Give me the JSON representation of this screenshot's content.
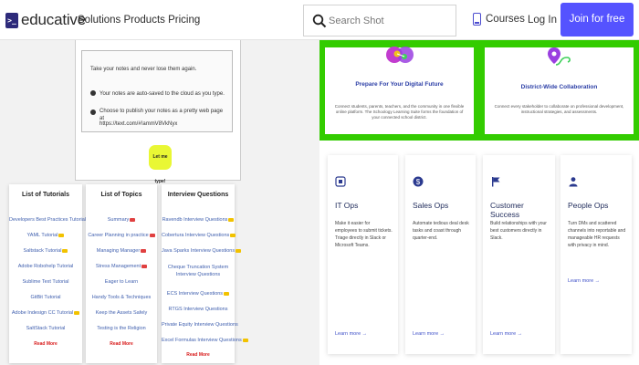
{
  "header": {
    "logo_text": "educative",
    "logo_glyph": ">_",
    "nav": "Solutions Products Pricing",
    "search_placeholder": "Search Shot",
    "courses": "Courses",
    "login": "Log In",
    "join": "Join for free",
    "accent_color": "#5553ff"
  },
  "promo": {
    "line1": "Take your notes and never lose them again.",
    "bullet1": "Your notes are auto-saved to the cloud as you type.",
    "bullet2a": "Choose to publish your notes as a pretty web page at",
    "bullet2b": "https://text.com/#!ammV8VkNyx",
    "button": "Let me type!"
  },
  "tutorials": {
    "title": "List of Tutorials",
    "items": [
      "Developers Best Practices Tutorial",
      "YAML Tutorial",
      "Saltstack Tutorial",
      "Adobe Robohelp Tutorial",
      "Sublime Text Tutorial",
      "GitBit Tutorial",
      "Adobe Indesign CC Tutorial",
      "SaltStack Tutorial"
    ],
    "more": "Read More"
  },
  "topics": {
    "title": "List of Topics",
    "items": [
      "Summary",
      "Career Planning in practice",
      "Managing Manager",
      "Stress Management",
      "Eager to Learn",
      "Handy Tools & Techniques",
      "Keep the Assets Safely",
      "Testing is the Religion"
    ],
    "more": "Read More"
  },
  "interview": {
    "title": "Interview Questions",
    "items": [
      "Ravendb Interview Questions",
      "Cobertura Interview Questions",
      "Java Sparks Interview Questions",
      "Cheque Truncation System Interview Questions",
      "ECS Interview Questions",
      "RTGS Interview Questions",
      "Private Equity Interview Questions",
      "Excel Formulas Interview Questions"
    ],
    "more": "Read More"
  },
  "features": [
    {
      "title": "Prepare For Your Digital Future",
      "desc": "Connect students, parents, teachers, and the community in one flexible online platform. The Schoology Learning Suite forms the foundation of your connected school district."
    },
    {
      "title": "District-Wide Collaboration",
      "desc": "Connect every stakeholder to collaborate on professional development, instructional strategies, and assessments."
    }
  ],
  "ops": [
    {
      "title": "IT Ops",
      "desc": "Make it easier for employees to submit tickets. Triage directly in Slack or Microsoft Teams.",
      "learn": "Learn more →"
    },
    {
      "title": "Sales Ops",
      "desc": "Automate tedious deal desk tasks and coast through quarter-end.",
      "learn": "Learn more →"
    },
    {
      "title": "Customer Success",
      "desc": "Build relationships with your best customers directly in Slack.",
      "learn": "Learn more →"
    },
    {
      "title": "People Ops",
      "desc": "Turn DMs and scattered channels into reportable and manageable HR requests with privacy in mind.",
      "learn": "Learn more →"
    }
  ]
}
